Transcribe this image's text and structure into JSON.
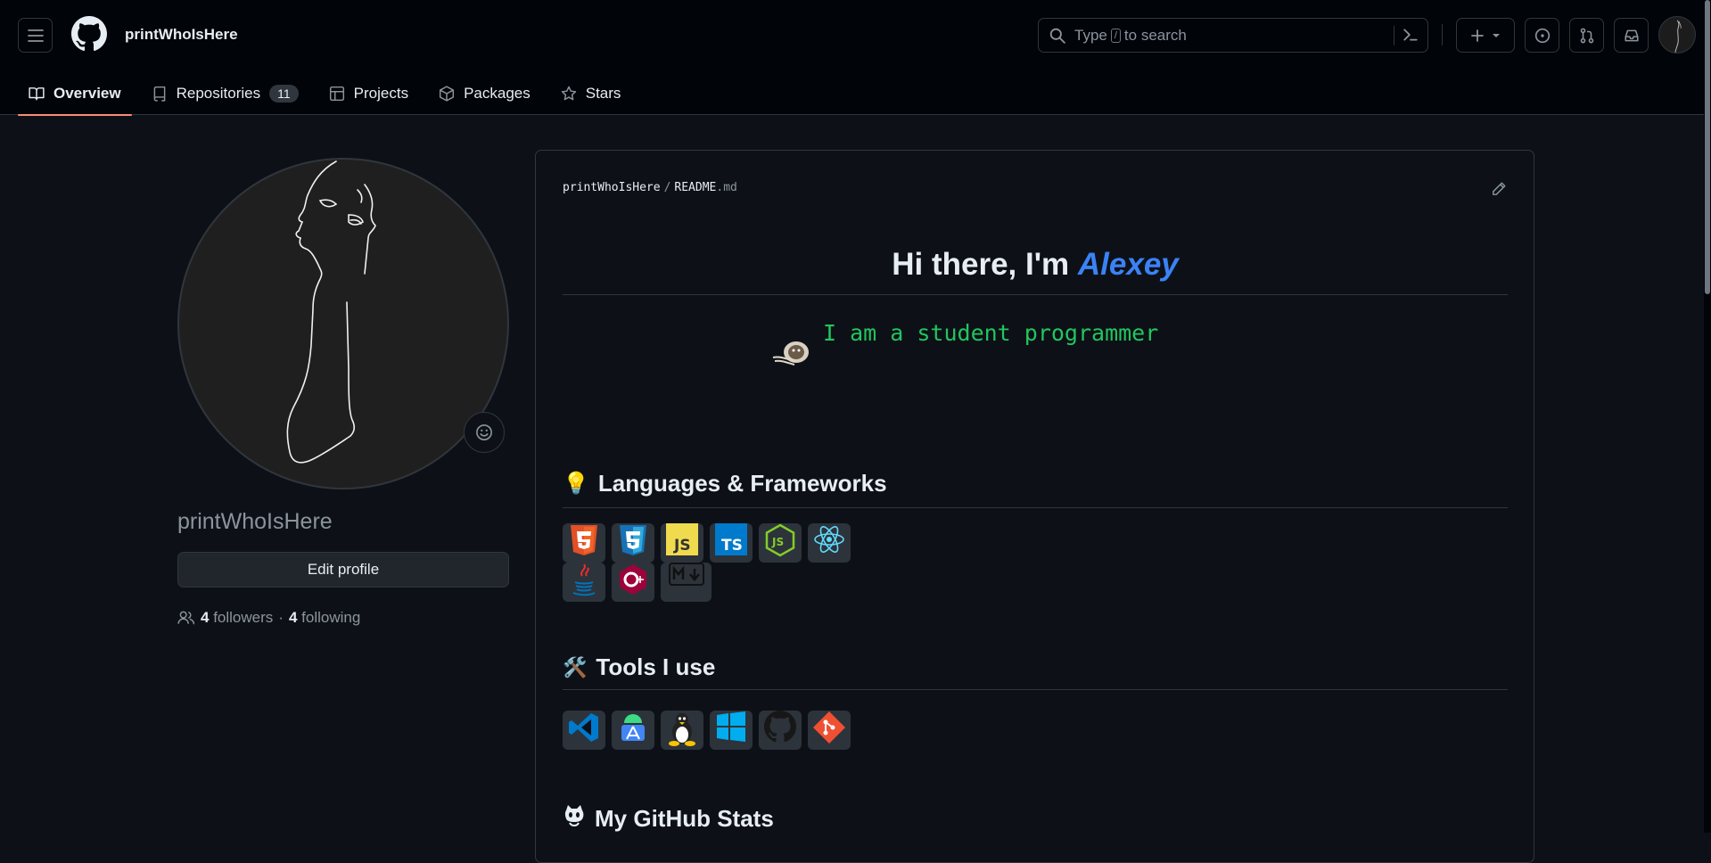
{
  "header": {
    "username": "printWhoIsHere",
    "search": {
      "prefix": "Type",
      "key": "/",
      "suffix": "to search"
    }
  },
  "tabs": [
    {
      "label": "Overview"
    },
    {
      "label": "Repositories",
      "count": "11"
    },
    {
      "label": "Projects"
    },
    {
      "label": "Packages"
    },
    {
      "label": "Stars"
    }
  ],
  "profile": {
    "name": "printWhoIsHere",
    "edit_label": "Edit profile",
    "followers_count": "4",
    "followers_label": "followers",
    "separator": "·",
    "following_count": "4",
    "following_label": "following"
  },
  "readme": {
    "path_owner": "printWhoIsHere",
    "path_sep": "/",
    "path_file": "README",
    "path_ext": ".md",
    "greeting": "Hi there, I'm ",
    "greeting_name": "Alexey",
    "typing_text": "I am a student programmer",
    "sections": {
      "languages": "Languages & Frameworks",
      "tools": "Tools I use",
      "stats": "My GitHub Stats"
    },
    "languages_row1": [
      "HTML5",
      "CSS3",
      "JS",
      "TS",
      "Node.js",
      "React"
    ],
    "languages_row2": [
      "Java",
      "C++",
      "Markdown"
    ],
    "tools": [
      "VS Code",
      "Android Studio",
      "Linux",
      "Windows",
      "GitHub",
      "Git"
    ]
  },
  "colors": {
    "accent_tab": "#fd8c73",
    "name_accent": "#3b82f6",
    "typing_green": "#22c55e"
  }
}
